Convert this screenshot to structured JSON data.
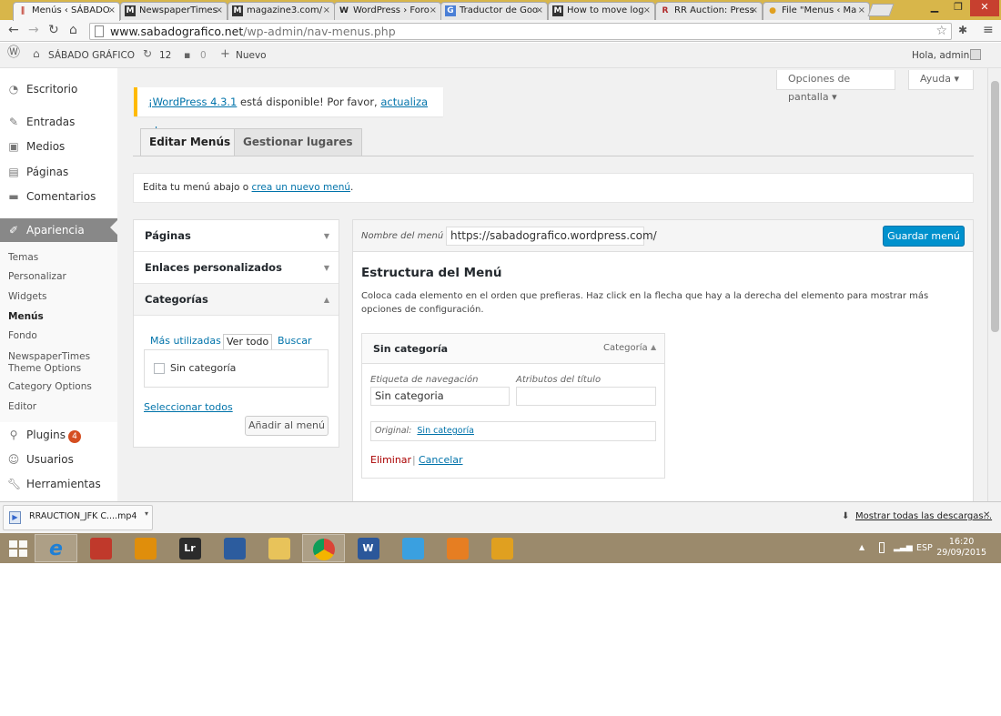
{
  "browser": {
    "tabs": [
      {
        "label": "Menús ‹ SÁBADO",
        "icon": "wordpress-red-icon",
        "active": true
      },
      {
        "label": "NewspaperTimes",
        "icon": "m-icon"
      },
      {
        "label": "magazine3.com/",
        "icon": "m-icon"
      },
      {
        "label": "WordPress › Foro",
        "icon": "wordpress-icon"
      },
      {
        "label": "Traductor de Goo",
        "icon": "translate-icon"
      },
      {
        "label": "How to move log",
        "icon": "m-icon"
      },
      {
        "label": "RR Auction: Press",
        "icon": "rr-icon"
      },
      {
        "label": "File \"Menus ‹ Ma",
        "icon": "file-icon"
      }
    ],
    "url_domain": "www.sabadografico.net",
    "url_path": "/wp-admin/nav-menus.php"
  },
  "adminbar": {
    "site_name": "SÁBADO GRÁFICO",
    "updates_count": "12",
    "comments_count": "0",
    "new_label": "Nuevo",
    "greeting": "Hola, admin"
  },
  "sidebar": {
    "items": [
      {
        "label": "Escritorio",
        "icon": "dashboard-icon"
      },
      {
        "label": "Entradas",
        "icon": "pin-icon"
      },
      {
        "label": "Medios",
        "icon": "media-icon"
      },
      {
        "label": "Páginas",
        "icon": "page-icon"
      },
      {
        "label": "Comentarios",
        "icon": "comment-icon"
      },
      {
        "label": "Apariencia",
        "icon": "brush-icon"
      }
    ],
    "submenu": [
      "Temas",
      "Personalizar",
      "Widgets",
      "Menús",
      "Fondo",
      "NewspaperTimes Theme Options",
      "Category Options",
      "Editor"
    ],
    "plugins_label": "Plugins",
    "plugins_badge": "4",
    "users_label": "Usuarios",
    "tools_label": "Herramientas"
  },
  "screen_options": "Opciones de pantalla",
  "help": "Ayuda",
  "notice": {
    "link": "¡WordPress 4.3.1",
    "text": " está disponible! Por favor, ",
    "action": "actualiza ahora",
    "end": "."
  },
  "tabs": {
    "edit": "Editar Menús",
    "locations": "Gestionar lugares"
  },
  "manage": {
    "prefix": "Edita tu menú abajo o ",
    "link": "crea un nuevo menú",
    "suffix": "."
  },
  "accordion": {
    "pages": "Páginas",
    "custom_links": "Enlaces personalizados",
    "categories": "Categorías",
    "cat_tabs": {
      "most_used": "Más utilizadas",
      "all": "Ver todo",
      "search": "Buscar"
    },
    "cat_item": "Sin categoría",
    "select_all": "Seleccionar todos",
    "add_button": "Añadir al menú"
  },
  "editor": {
    "menu_name_label": "Nombre del menú",
    "menu_name_value": "https://sabadografico.wordpress.com/",
    "save_button": "Guardar menú",
    "structure_title": "Estructura del Menú",
    "structure_desc": "Coloca cada elemento en el orden que prefieras. Haz click en la flecha que hay a la derecha del elemento para mostrar más opciones de configuración.",
    "item": {
      "title": "Sin categoría",
      "type": "Categoría",
      "nav_label_label": "Etiqueta de navegación",
      "nav_label_value": "Sin categoria",
      "title_attr_label": "Atributos del título",
      "title_attr_value": "",
      "original_label": "Original:",
      "original_link": "Sin categoría",
      "remove": "Eliminar",
      "separator": "|",
      "cancel": "Cancelar"
    }
  },
  "downloads": {
    "file": "RRAUCTION_JFK C....mp4",
    "show_all": "Mostrar todas las descargas..."
  },
  "taskbar": {
    "apps": [
      {
        "icon": "ie-icon",
        "color": "#1e7fd6"
      },
      {
        "icon": "photo-app-icon",
        "color": "#c0392b"
      },
      {
        "icon": "notes-icon",
        "color": "#e08e0b"
      },
      {
        "icon": "lightroom-icon",
        "color": "#2b2b2b",
        "text": "Lr"
      },
      {
        "icon": "pen-app-icon",
        "color": "#2c5c9e"
      },
      {
        "icon": "folder-icon",
        "color": "#e8c35a"
      },
      {
        "icon": "chrome-icon",
        "color": "#db4437"
      },
      {
        "icon": "word-icon",
        "color": "#2b579a",
        "text": "W"
      },
      {
        "icon": "quicktime-icon",
        "color": "#3aa0e0"
      },
      {
        "icon": "media-player-icon",
        "color": "#e67e22"
      },
      {
        "icon": "outlook-icon",
        "color": "#e0a020"
      }
    ],
    "lang": "ESP",
    "time": "16:20",
    "date": "29/09/2015"
  }
}
